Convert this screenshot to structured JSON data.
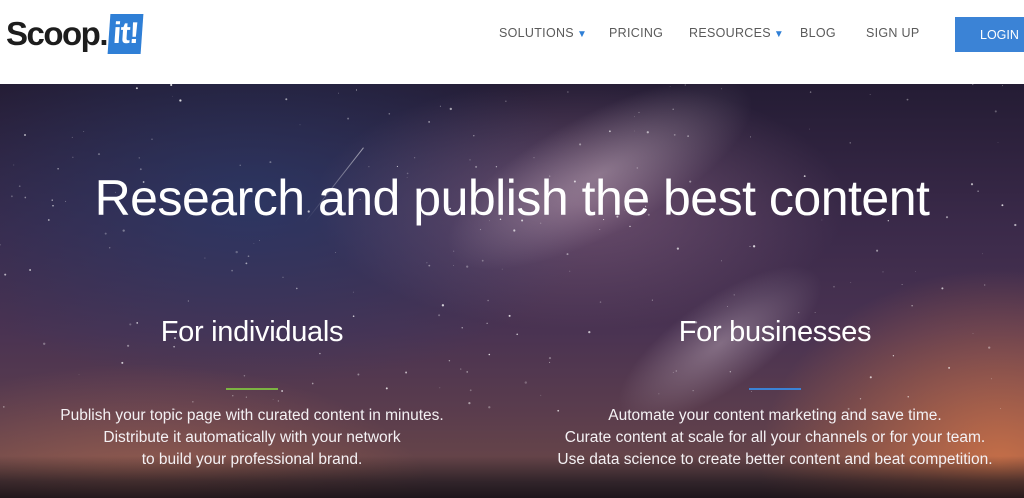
{
  "logo": {
    "part1": "Scoop.",
    "part2": "it!"
  },
  "nav": {
    "solutions": "SOLUTIONS",
    "pricing": "PRICING",
    "resources": "RESOURCES",
    "blog": "BLOG",
    "signup": "SIGN UP",
    "login": "LOGIN",
    "caret": "▼"
  },
  "hero": {
    "title": "Research and publish the best content",
    "individuals": {
      "heading": "For individuals",
      "lines": [
        "Publish your topic page with curated content in minutes.",
        "Distribute it automatically with your network",
        "to build your professional brand."
      ]
    },
    "businesses": {
      "heading": "For businesses",
      "lines": [
        "Automate your content marketing and save time.",
        "Curate content at scale for all your channels or for your team.",
        "Use data science to create better content and beat competition."
      ]
    }
  },
  "colors": {
    "accent": "#3b83d6",
    "individuals_divider": "#7cb342",
    "businesses_divider": "#3b83d6"
  }
}
